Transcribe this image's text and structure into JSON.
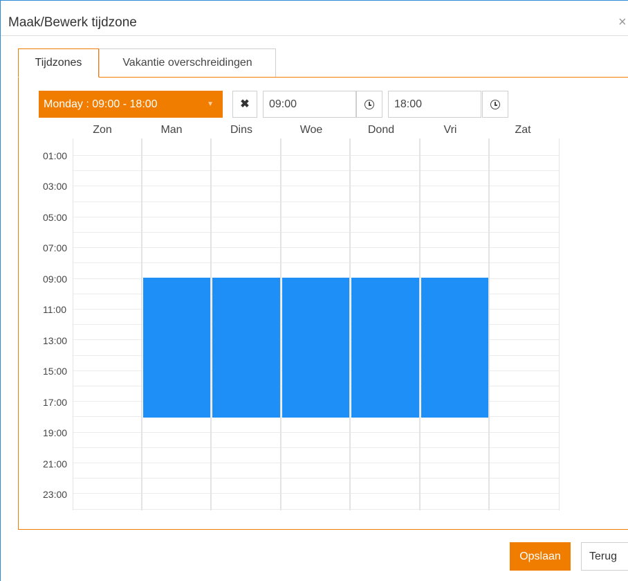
{
  "dialog": {
    "title": "Maak/Bewerk tijdzone",
    "close_glyph": "×"
  },
  "tabs": [
    {
      "label": "Tijdzones",
      "active": true
    },
    {
      "label": "Vakantie overschreidingen",
      "active": false
    }
  ],
  "toolbar": {
    "selected_timezone": "Monday : 09:00 - 18:00",
    "select_arrow": "▼",
    "clear_glyph": "✖",
    "start_time": "09:00",
    "end_time": "18:00"
  },
  "schedule": {
    "days": [
      "Zon",
      "Man",
      "Dins",
      "Woe",
      "Dond",
      "Vri",
      "Zat"
    ],
    "hour_labels": [
      "01:00",
      "03:00",
      "05:00",
      "07:00",
      "09:00",
      "11:00",
      "13:00",
      "15:00",
      "17:00",
      "19:00",
      "21:00",
      "23:00"
    ],
    "blocks": [
      {
        "day": "Man",
        "start": "09:00",
        "end": "18:00"
      },
      {
        "day": "Dins",
        "start": "09:00",
        "end": "18:00"
      },
      {
        "day": "Woe",
        "start": "09:00",
        "end": "18:00"
      },
      {
        "day": "Dond",
        "start": "09:00",
        "end": "18:00"
      },
      {
        "day": "Vri",
        "start": "09:00",
        "end": "18:00"
      }
    ],
    "block_color": "#1e8ff6"
  },
  "footer": {
    "save_label": "Opslaan",
    "back_label": "Terug"
  },
  "colors": {
    "accent": "#f07d00",
    "frame": "#2d8ad6"
  }
}
